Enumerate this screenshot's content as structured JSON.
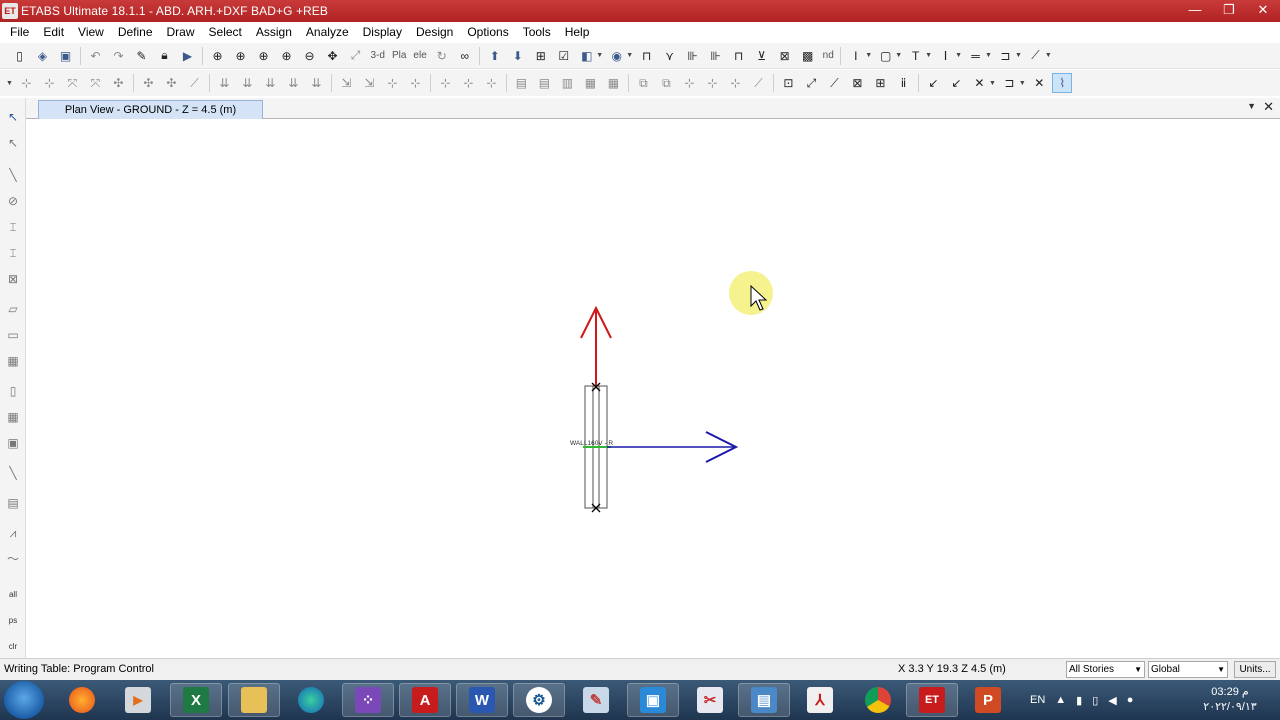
{
  "window": {
    "app_logo": "ET",
    "title": "ETABS Ultimate 18.1.1 - ABD. ARH.+DXF BAD+G  +REB",
    "minimize": "—",
    "restore": "❐",
    "close": "✕"
  },
  "menu": [
    "File",
    "Edit",
    "View",
    "Define",
    "Draw",
    "Select",
    "Assign",
    "Analyze",
    "Display",
    "Design",
    "Options",
    "Tools",
    "Help"
  ],
  "toolbar": {
    "view_3d": "3-d",
    "plan": "Pla",
    "elev": "ele",
    "nd": "nd"
  },
  "left_tools": {
    "all": "all",
    "ps": "ps",
    "clr": "clr"
  },
  "view_tab": {
    "title": "Plan View - GROUND - Z = 4.5 (m)",
    "menu_icon": "▼",
    "close_icon": "✕"
  },
  "drawing": {
    "wall_label": "WALL160V - R",
    "colors": {
      "y_axis": "#d01818",
      "x_axis": "#1a1aa8",
      "wall": "#505050",
      "wall_center": "#2eb82e",
      "cursor_highlight": "#f5f07a"
    }
  },
  "status": {
    "message": "Writing Table: Program Control",
    "coords": "X 3.3  Y 19.3  Z 4.5 (m)",
    "stories": "All Stories",
    "coord_system": "Global",
    "units": "Units..."
  },
  "taskbar": {
    "apps": [
      "firefox",
      "media",
      "excel",
      "explorer",
      "edge",
      "grid-app",
      "autocad",
      "word",
      "settings",
      "paint",
      "snip",
      "tool",
      "photos",
      "pdf",
      "chrome",
      "etabs",
      "powerpoint"
    ],
    "lang": "EN",
    "time": "03:29 م",
    "date": "٢٠٢٢/٠٩/١٣"
  }
}
